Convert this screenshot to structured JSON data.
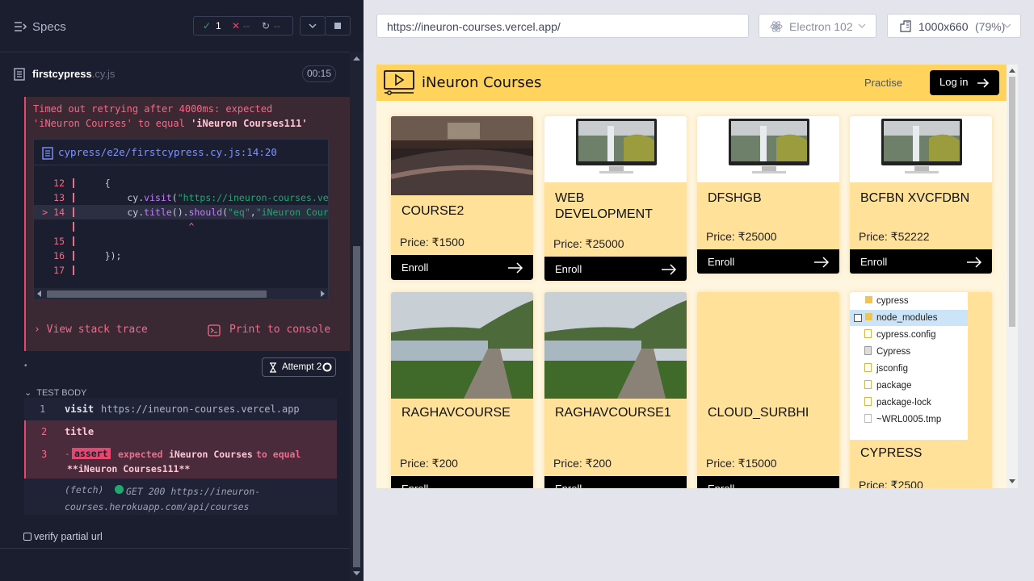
{
  "runner": {
    "specs_label": "Specs",
    "passed": "1",
    "failed": "--",
    "pending": "--",
    "file_name": "firstcypress",
    "file_ext": ".cy.js",
    "duration": "00:15",
    "error": {
      "prefix": "Timed out retrying after 4000ms: expected 'iNeuron Courses' to equal ",
      "expected": "'iNeuron Courses111'"
    },
    "code_path": "cypress/e2e/firstcypress.cy.js:14:20",
    "code_lines": [
      {
        "num": "12",
        "text": "    {"
      },
      {
        "num": "13",
        "text": "        cy.visit(\"https://ineuron-courses.vercel.app\")"
      },
      {
        "num": "> 14",
        "text": "        cy.title().should(\"eq\",\"iNeuron Courses111\")"
      },
      {
        "num": "",
        "text": "                   ^"
      },
      {
        "num": "15",
        "text": ""
      },
      {
        "num": "16",
        "text": "    });"
      },
      {
        "num": "17",
        "text": ""
      }
    ],
    "view_stack_trace": "View stack trace",
    "print_to_console": "Print to console",
    "attempt": "Attempt 2",
    "test_body_label": "TEST BODY",
    "commands": [
      {
        "num": "1",
        "name": "visit",
        "message": "https://ineuron-courses.vercel.app"
      },
      {
        "num": "2",
        "name": "title",
        "message": ""
      },
      {
        "num": "3",
        "name": "-assert",
        "badge": "assert",
        "expected_word": "expected",
        "actual": "iNeuron Courses",
        "to_equal": "to equal",
        "target": "**iNeuron Courses111**"
      }
    ],
    "fetch": {
      "label": "(fetch)",
      "text": "GET 200 https://ineuron-courses.herokuapp.com/api/courses"
    },
    "next_test": "verify partial url"
  },
  "aut": {
    "url": "https://ineuron-courses.vercel.app/",
    "browser": "Electron 102",
    "viewport": "1000x660",
    "zoom": "(79%)"
  },
  "site": {
    "brand": "iNeuron Courses",
    "practise": "Practise",
    "login": "Log in",
    "enroll_label": "Enroll",
    "courses": [
      {
        "title": "COURSE2",
        "price": "Price: ₹1500",
        "image": "auditorium-photo"
      },
      {
        "title": "WEB DEVELOPMENT",
        "price": "Price: ₹25000",
        "image": "imac-waterfall"
      },
      {
        "title": "DFSHGB",
        "price": "Price: ₹25000",
        "image": "imac-waterfall"
      },
      {
        "title": "BCFBN XVCFDBN",
        "price": "Price: ₹52222",
        "image": "imac-waterfall"
      },
      {
        "title": "RAGHAVCOURSE",
        "price": "Price: ₹200",
        "image": "park-path-photo"
      },
      {
        "title": "RAGHAVCOURSE1",
        "price": "Price: ₹200",
        "image": "park-path-photo"
      },
      {
        "title": "CLOUD_SURBHI",
        "price": "Price: ₹15000",
        "image": "none"
      },
      {
        "title": "CYPRESS",
        "price": "Price: ₹2500",
        "image": "file-explorer-screenshot"
      }
    ],
    "explorer_items": [
      "cypress",
      "node_modules",
      "cypress.config",
      "Cypress",
      "jsconfig",
      "package",
      "package-lock",
      "~WRL0005.tmp"
    ]
  }
}
